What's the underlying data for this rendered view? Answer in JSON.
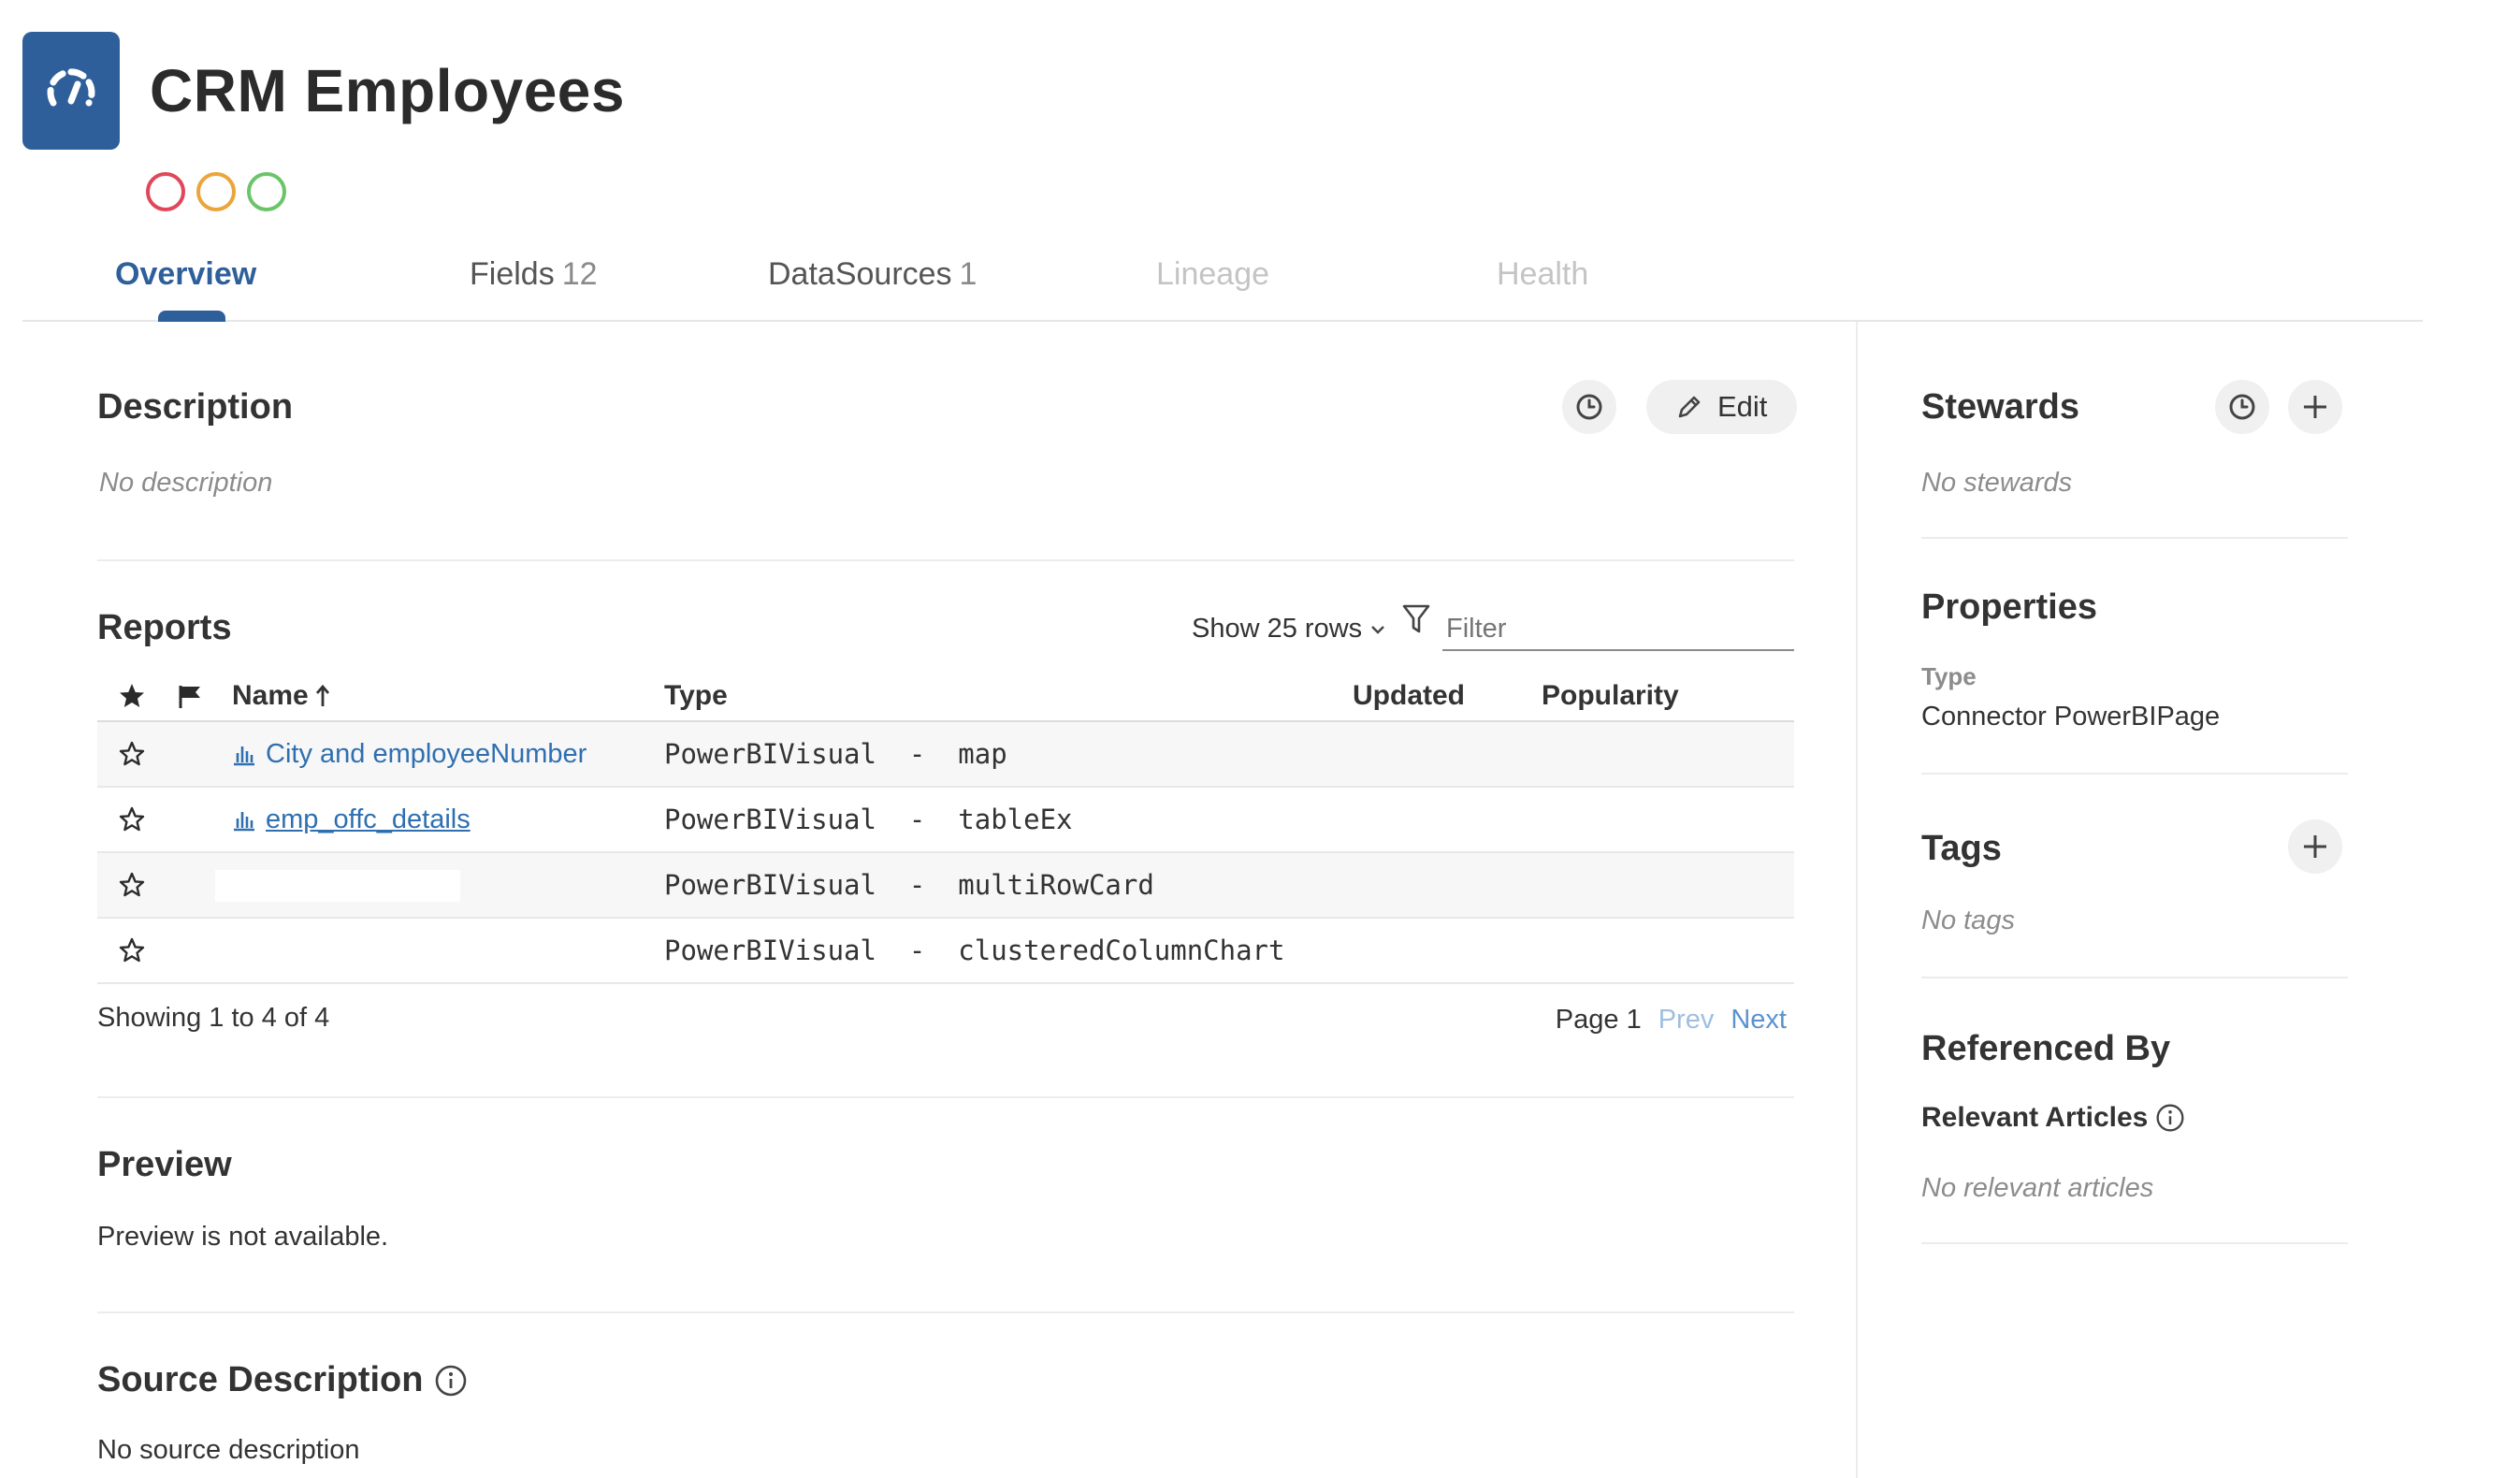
{
  "header": {
    "title": "CRM Employees",
    "app_icon": "gauge-icon",
    "accent": "#2f5f9a",
    "status_circles": [
      {
        "name": "red-status",
        "color": "#e0475b"
      },
      {
        "name": "orange-status",
        "color": "#eba53a"
      },
      {
        "name": "green-status",
        "color": "#6cc46a"
      }
    ]
  },
  "tabs": {
    "overview": {
      "label": "Overview"
    },
    "fields": {
      "label": "Fields",
      "count": "12"
    },
    "datasources": {
      "label": "DataSources",
      "count": "1"
    },
    "lineage": {
      "label": "Lineage"
    },
    "health": {
      "label": "Health"
    }
  },
  "description": {
    "title": "Description",
    "empty": "No description",
    "edit_label": "Edit"
  },
  "reports": {
    "title": "Reports",
    "show_rows_label": "Show 25 rows",
    "filter_placeholder": "Filter",
    "columns": {
      "name": "Name",
      "type": "Type",
      "updated": "Updated",
      "popularity": "Popularity"
    },
    "rows": [
      {
        "name": "City and employeeNumber",
        "type": "PowerBIVisual  -  map"
      },
      {
        "name": "emp_offc_details",
        "type": "PowerBIVisual  -  tableEx"
      },
      {
        "name": "",
        "type": "PowerBIVisual  -  multiRowCard"
      },
      {
        "name": "",
        "type": "PowerBIVisual  -  clusteredColumnChart"
      }
    ],
    "showing": "Showing 1 to 4 of 4",
    "page_label": "Page 1",
    "prev": "Prev",
    "next": "Next"
  },
  "preview": {
    "title": "Preview",
    "text": "Preview is not available."
  },
  "source_description": {
    "title": "Source Description",
    "text": "No source description"
  },
  "sidebar": {
    "stewards": {
      "title": "Stewards",
      "empty": "No stewards"
    },
    "properties": {
      "title": "Properties",
      "type_label": "Type",
      "type_value": "Connector PowerBIPage"
    },
    "tags": {
      "title": "Tags",
      "empty": "No tags"
    },
    "referenced_by": {
      "title": "Referenced By",
      "relevant_articles": "Relevant Articles",
      "empty": "No relevant articles"
    }
  }
}
